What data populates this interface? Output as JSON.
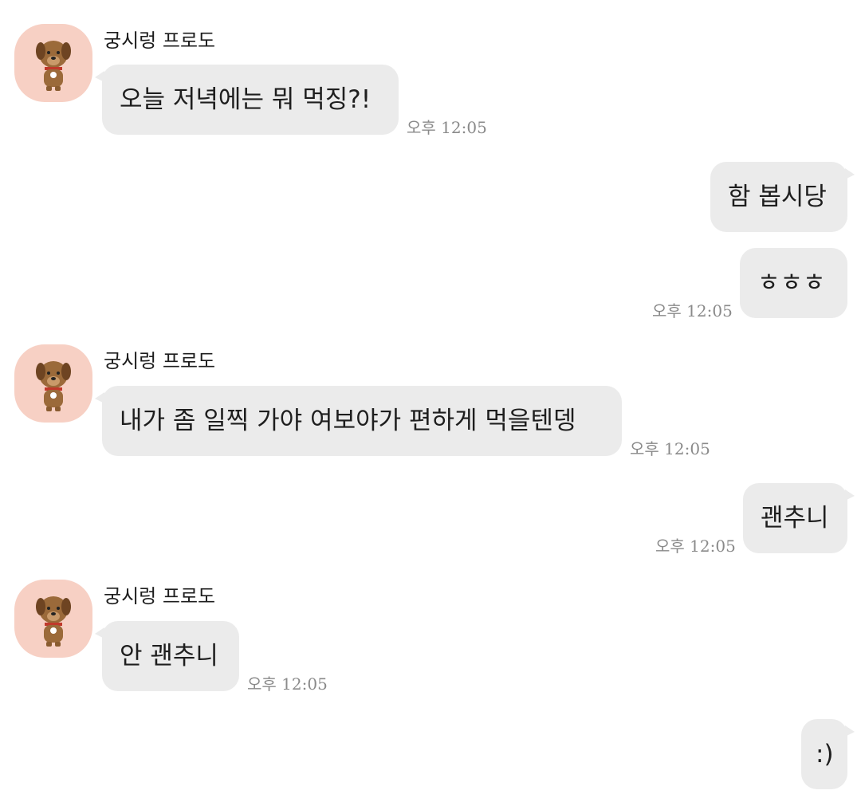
{
  "messages": [
    {
      "sender": "궁시렁 프로도",
      "text": "오늘 저녁에는 뭐 먹징?!",
      "time": "오후 12:05"
    },
    {
      "text": "함 봅시당"
    },
    {
      "text": "ㅎㅎㅎ",
      "time": "오후 12:05"
    },
    {
      "sender": "궁시렁 프로도",
      "text": "내가 좀 일찍 가야 여보야가 편하게 먹을텐뎅",
      "time": "오후 12:05"
    },
    {
      "text": "괜추니",
      "time": "오후 12:05"
    },
    {
      "sender": "궁시렁 프로도",
      "text": "안 괜추니",
      "time": "오후 12:05"
    },
    {
      "text": ":)"
    }
  ],
  "avatar": {
    "icon": "brown-dog-character-icon",
    "background": "#f7d0c4"
  },
  "colors": {
    "bubble": "#ebebeb",
    "time": "#8a8a8a"
  }
}
